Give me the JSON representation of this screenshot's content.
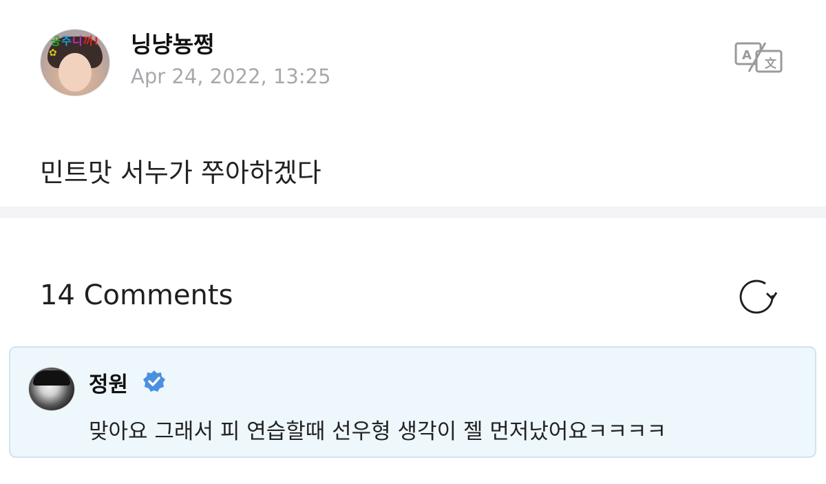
{
  "post": {
    "author": "닝냥뇽쩡",
    "date": "Apr 24, 2022, 13:25",
    "body": "민트맛 서누가 쭈아하겠다",
    "avatar_sticker": [
      "공",
      "주",
      "니",
      "까!"
    ]
  },
  "comments": {
    "title": "14 Comments",
    "items": [
      {
        "author": "정원",
        "verified": true,
        "text": "맞아요 그래서 피 연습할때 선우형 생각이 젤 먼저났어요ㅋㅋㅋㅋ"
      }
    ]
  },
  "icons": {
    "translate": "translate-icon",
    "refresh": "refresh-icon",
    "verified": "verified-badge-icon"
  },
  "colors": {
    "comment_card_bg": "#eef7fc",
    "comment_card_border": "#cfe4ef",
    "verified_blue": "#4a90e2",
    "date_gray": "#a8a8ae"
  }
}
